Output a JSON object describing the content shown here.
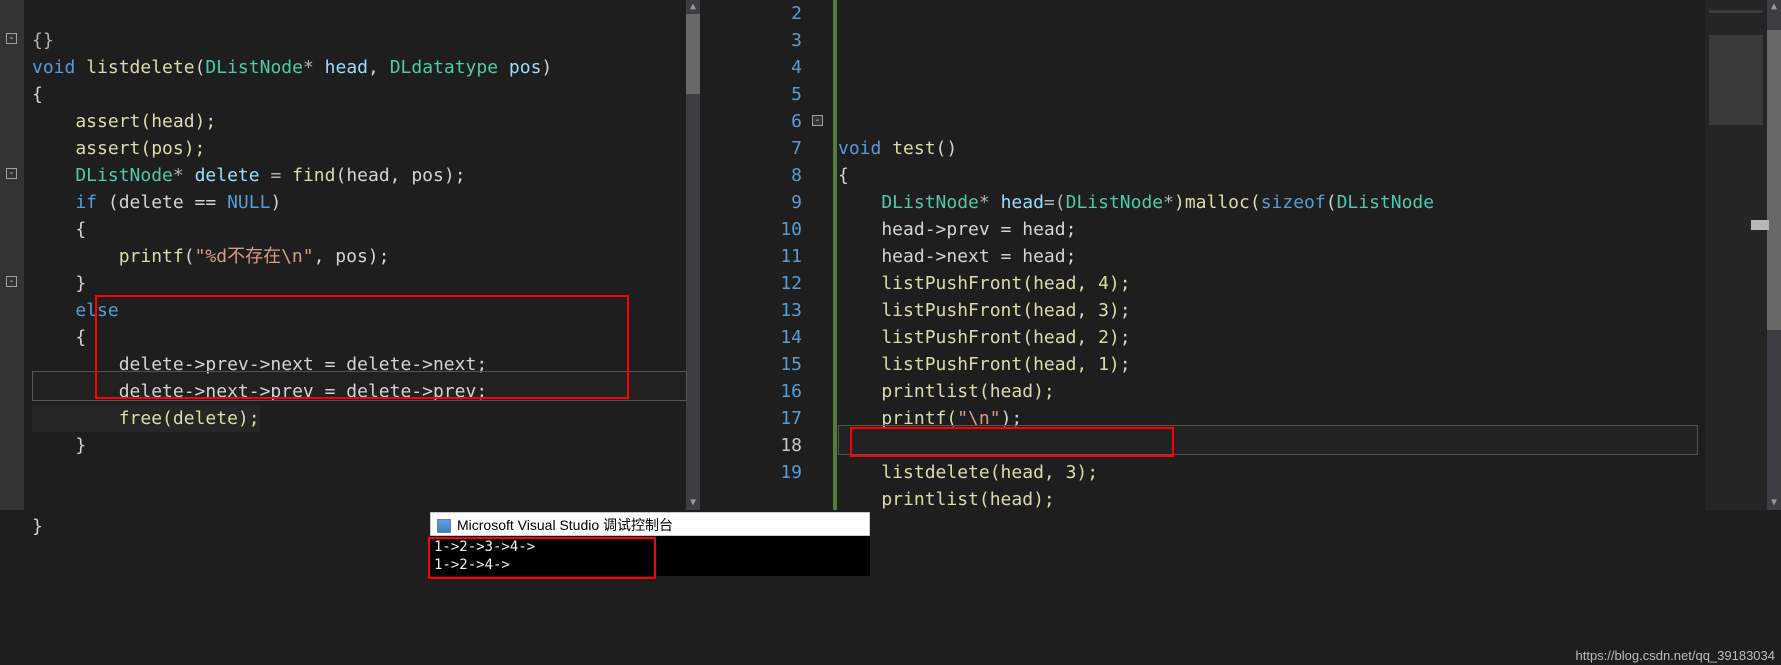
{
  "left_pane": {
    "lines": {
      "l0": "{}",
      "fn_kw": "void",
      "fn_name": " listdelete",
      "fn_params_open": "(",
      "fn_type1": "DListNode",
      "fn_star": "*",
      "fn_p1": " head",
      "fn_comma": ", ",
      "fn_type2": "DLdatatype",
      "fn_p2": " pos",
      "fn_params_close": ")",
      "brace_open": "{",
      "assert1": "    assert(head);",
      "assert2": "    assert(pos);",
      "decl_type": "    DListNode",
      "decl_star": "*",
      "decl_name": " delete ",
      "decl_eq": "= ",
      "decl_call": "find",
      "decl_args": "(head, pos);",
      "if_kw": "    if ",
      "if_cond": "(delete == ",
      "if_null": "NULL",
      "if_close": ")",
      "if_brace": "    {",
      "printf_call": "        printf",
      "printf_open": "(",
      "printf_str": "\"%d不存在\\n\"",
      "printf_rest": ", pos);",
      "if_brace_c": "    }",
      "else_kw": "    else",
      "else_brace": "    {",
      "del_l1": "        delete->prev->next = delete->next;",
      "del_l2": "        delete->next->prev = delete->prev;",
      "del_l3": "        free(delete);",
      "else_brace_c": "    }",
      "brace_close": "}"
    }
  },
  "right_pane": {
    "line_numbers": [
      "2",
      "3",
      "4",
      "5",
      "6",
      "7",
      "8",
      "9",
      "10",
      "11",
      "12",
      "13",
      "14",
      "15",
      "16",
      "17",
      "18",
      "19"
    ],
    "lines": {
      "fn_kw": "void",
      "fn_name": " test",
      "fn_paren": "()",
      "brace_open": "{",
      "l8a": "    DListNode",
      "l8star": "*",
      "l8b": " head",
      "l8eq": "=(",
      "l8c": "DListNode",
      "l8star2": "*",
      "l8d": ")malloc(",
      "l8e": "sizeof",
      "l8f": "(",
      "l8g": "DListNode",
      "l9": "    head->prev = head;",
      "l10": "    head->next = head;",
      "l11": "    listPushFront(head, 4);",
      "l12": "    listPushFront(head, 3);",
      "l13": "    listPushFront(head, 2);",
      "l14": "    listPushFront(head, 1);",
      "l15": "    printlist(head);",
      "l16a": "    printf(",
      "l16b": "\"\\n\"",
      "l16c": ");",
      "l18": "    listdelete(head, 3);",
      "l19": "    printlist(head);"
    }
  },
  "console": {
    "title": "Microsoft Visual Studio 调试控制台",
    "out1": "1->2->3->4->",
    "out2": "1->2->4->"
  },
  "watermark": "https://blog.csdn.net/qq_39183034"
}
